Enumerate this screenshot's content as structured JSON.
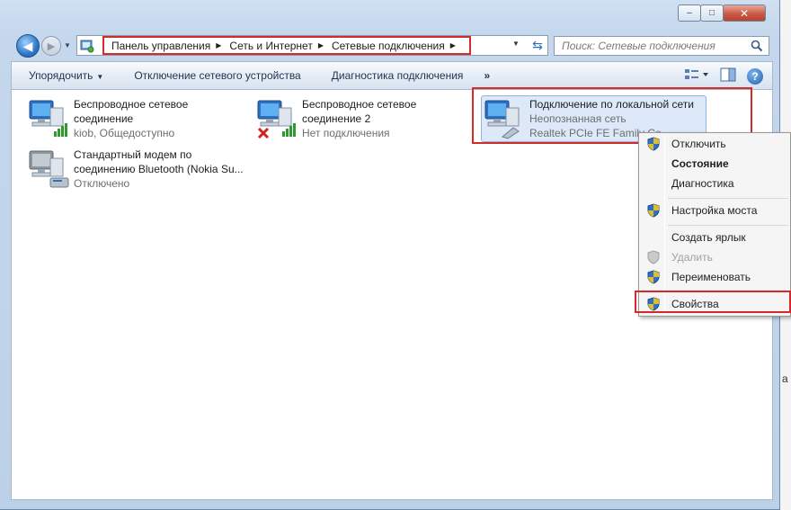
{
  "window": {
    "caption": {
      "minimize": "–",
      "maximize": "□",
      "close": "✕"
    }
  },
  "nav": {
    "back_glyph": "◀",
    "forward_glyph": "▶",
    "breadcrumb": [
      "Панель управления",
      "Сеть и Интернет",
      "Сетевые подключения"
    ],
    "search_placeholder": "Поиск: Сетевые подключения"
  },
  "toolbar": {
    "organize": "Упорядочить",
    "disable_device": "Отключение сетевого устройства",
    "diagnose": "Диагностика подключения",
    "more": "»",
    "help": "?"
  },
  "connections": [
    {
      "name1": "Беспроводное сетевое",
      "name2": "соединение",
      "status": "kiob, Общедоступно"
    },
    {
      "name1": "Беспроводное сетевое",
      "name2": "соединение 2",
      "status": "Нет подключения"
    },
    {
      "name1": "Подключение по локальной сети",
      "status1": "Неопознанная сеть",
      "status2": "Realtek PCIe FE Family Co"
    },
    {
      "name1": "Стандартный модем по",
      "name2": "соединению Bluetooth (Nokia Su...",
      "status": "Отключено"
    }
  ],
  "context_menu": {
    "items": [
      "Отключить",
      "Состояние",
      "Диагностика",
      "Настройка моста",
      "Создать ярлык",
      "Удалить",
      "Переименовать",
      "Свойства"
    ]
  },
  "colors": {
    "highlight_red": "#d42a2a",
    "selection": "#dde9f8",
    "signal_green": "#2e9b2e"
  },
  "background_char": "а"
}
